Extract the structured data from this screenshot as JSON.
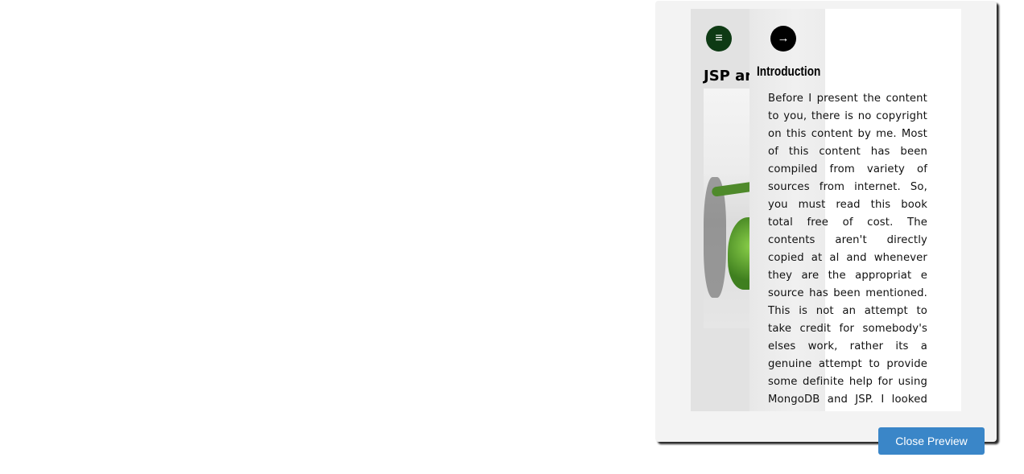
{
  "preview": {
    "menu_icon": "menu-icon",
    "next_icon": "arrow-right-icon",
    "menu_glyph": "≡",
    "next_glyph": "→",
    "cover_title": "JSP and",
    "intro_title": "Introduction",
    "intro_text": "Before I present the content to you, there is no copyright on this content by me. Most of this content has been compiled from variety of sources from internet. So, you must read this book total free of cost. The contents aren't directly copied at al and whenever they are the appropriat e source has been mentioned. This is not an attempt to take credit for somebody's elses work, rather its a genuine attempt to provide some definite help for using MongoDB and JSP. I looked on web for books on this topic but couldn't really find one, so this effort. I hope you appredate the effort along with the intentions."
  },
  "actions": {
    "close_label": "Close Preview"
  },
  "colors": {
    "modal_bg": "#f3f3f3",
    "menu_button": "#0e3a14",
    "next_button": "#000000",
    "close_button": "#3a86c8"
  }
}
